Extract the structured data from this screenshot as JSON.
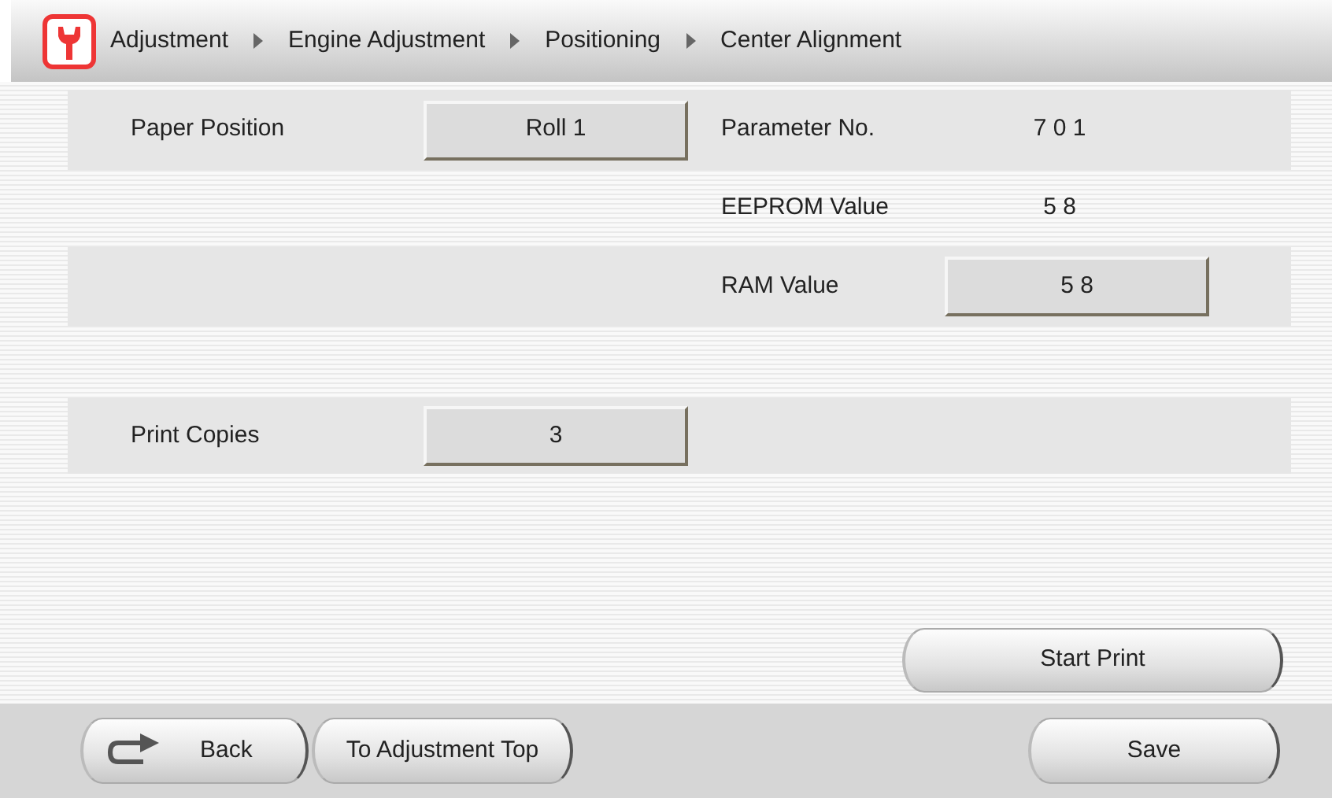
{
  "breadcrumb": [
    "Adjustment",
    "Engine Adjustment",
    "Positioning",
    "Center Alignment"
  ],
  "parameter_rows": [
    {
      "shaded": true,
      "label": "Paper Position",
      "button": "Roll 1",
      "right_label": "Parameter No.",
      "right_value": "7 0 1"
    },
    {
      "shaded": false,
      "right_label": "EEPROM Value",
      "right_value": "5 8"
    },
    {
      "shaded": true,
      "right_label": "RAM Value",
      "right_button": "5 8"
    }
  ],
  "print_rows": [
    {
      "shaded": true,
      "label": "Print Copies",
      "button": "3"
    }
  ],
  "start_print": "Start Print",
  "footer": {
    "back": "Back",
    "top": "To Adjustment Top",
    "save": "Save"
  }
}
